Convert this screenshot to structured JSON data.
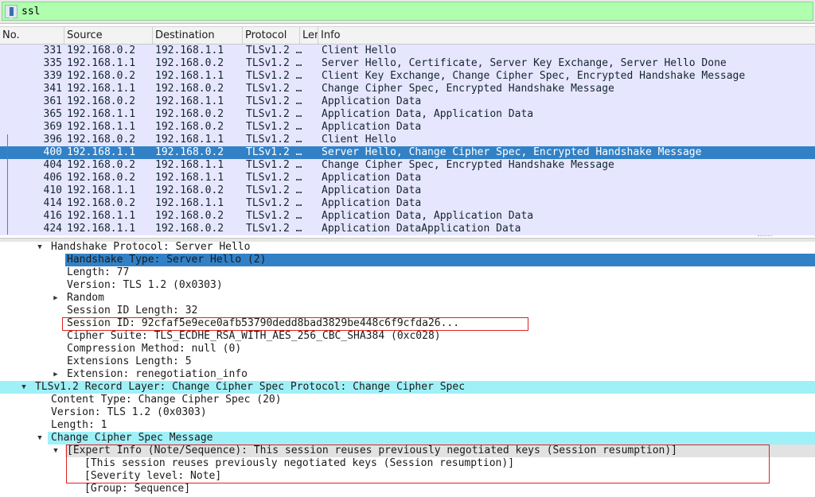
{
  "filter": {
    "value": "ssl",
    "bookmark_icon": "bookmark-icon"
  },
  "columns": [
    "No.",
    "Source",
    "Destination",
    "Protocol",
    "Ler",
    "Info"
  ],
  "packets": [
    {
      "no": "331",
      "src": "192.168.0.2",
      "dst": "192.168.1.1",
      "proto": "TLSv1.2 …",
      "info": "Client Hello"
    },
    {
      "no": "335",
      "src": "192.168.1.1",
      "dst": "192.168.0.2",
      "proto": "TLSv1.2 …",
      "info": "Server Hello, Certificate, Server Key Exchange, Server Hello Done"
    },
    {
      "no": "339",
      "src": "192.168.0.2",
      "dst": "192.168.1.1",
      "proto": "TLSv1.2 …",
      "info": "Client Key Exchange, Change Cipher Spec, Encrypted Handshake Message"
    },
    {
      "no": "341",
      "src": "192.168.1.1",
      "dst": "192.168.0.2",
      "proto": "TLSv1.2 …",
      "info": "Change Cipher Spec, Encrypted Handshake Message"
    },
    {
      "no": "361",
      "src": "192.168.0.2",
      "dst": "192.168.1.1",
      "proto": "TLSv1.2 …",
      "info": "Application Data"
    },
    {
      "no": "365",
      "src": "192.168.1.1",
      "dst": "192.168.0.2",
      "proto": "TLSv1.2 …",
      "info": "Application Data, Application Data"
    },
    {
      "no": "369",
      "src": "192.168.1.1",
      "dst": "192.168.0.2",
      "proto": "TLSv1.2 …",
      "info": "Application Data"
    },
    {
      "no": "396",
      "src": "192.168.0.2",
      "dst": "192.168.1.1",
      "proto": "TLSv1.2 …",
      "info": "Client Hello"
    },
    {
      "no": "400",
      "src": "192.168.1.1",
      "dst": "192.168.0.2",
      "proto": "TLSv1.2 …",
      "info": "Server Hello, Change Cipher Spec, Encrypted Handshake Message",
      "selected": true
    },
    {
      "no": "404",
      "src": "192.168.0.2",
      "dst": "192.168.1.1",
      "proto": "TLSv1.2 …",
      "info": "Change Cipher Spec, Encrypted Handshake Message"
    },
    {
      "no": "406",
      "src": "192.168.0.2",
      "dst": "192.168.1.1",
      "proto": "TLSv1.2 …",
      "info": "Application Data"
    },
    {
      "no": "410",
      "src": "192.168.1.1",
      "dst": "192.168.0.2",
      "proto": "TLSv1.2 …",
      "info": "Application Data"
    },
    {
      "no": "414",
      "src": "192.168.0.2",
      "dst": "192.168.1.1",
      "proto": "TLSv1.2 …",
      "info": "Application Data"
    },
    {
      "no": "416",
      "src": "192.168.1.1",
      "dst": "192.168.0.2",
      "proto": "TLSv1.2 …",
      "info": "Application Data, Application Data"
    },
    {
      "no": "424",
      "src": "192.168.1.1",
      "dst": "192.168.0.2",
      "proto": "TLSv1.2 …",
      "info": "Application DataApplication Data"
    }
  ],
  "details": [
    {
      "text": "Handshake Protocol: Server Hello",
      "level": 2,
      "arrow": "expanded"
    },
    {
      "text": "Handshake Type: Server Hello (2)",
      "level": 4,
      "style": "selected"
    },
    {
      "text": "Length: 77",
      "level": 4
    },
    {
      "text": "Version: TLS 1.2 (0x0303)",
      "level": 4
    },
    {
      "text": "Random",
      "level": 4,
      "arrow": "collapsed"
    },
    {
      "text": "Session ID Length: 32",
      "level": 4
    },
    {
      "text": "Session ID: 92cfaf5e9ece0afb53790dedd8bad3829be448c6f9cfda26...",
      "level": 4
    },
    {
      "text": "Cipher Suite: TLS_ECDHE_RSA_WITH_AES_256_CBC_SHA384 (0xc028)",
      "level": 4
    },
    {
      "text": "Compression Method: null (0)",
      "level": 4
    },
    {
      "text": "Extensions Length: 5",
      "level": 4
    },
    {
      "text": "Extension: renegotiation_info",
      "level": 4,
      "arrow": "collapsed"
    },
    {
      "text": "TLSv1.2 Record Layer: Change Cipher Spec Protocol: Change Cipher Spec",
      "level": 1,
      "arrow": "expanded",
      "style": "cyan"
    },
    {
      "text": "Content Type: Change Cipher Spec (20)",
      "level": 3
    },
    {
      "text": "Version: TLS 1.2 (0x0303)",
      "level": 3
    },
    {
      "text": "Length: 1",
      "level": 3
    },
    {
      "text": "Change Cipher Spec Message",
      "level": 3,
      "arrow": "expanded",
      "style": "cyan-right"
    },
    {
      "text": "[Expert Info (Note/Sequence): This session reuses previously negotiated keys (Session resumption)]",
      "level": 4,
      "arrow": "expanded",
      "style": "expert"
    },
    {
      "text": "[This session reuses previously negotiated keys (Session resumption)]",
      "level": 5
    },
    {
      "text": "[Severity level: Note]",
      "level": 5
    },
    {
      "text": "[Group: Sequence]",
      "level": 5
    }
  ],
  "colors": {
    "filter_valid": "#afffaf",
    "row_bg": "#e7e6ff",
    "selection": "#3281c6",
    "protocol_highlight": "#a0f0f8",
    "annotation_box": "#dd2222"
  }
}
